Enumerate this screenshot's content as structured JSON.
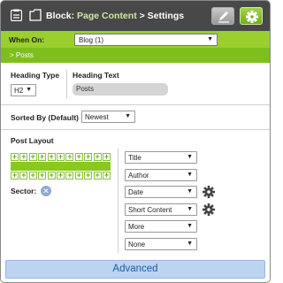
{
  "header": {
    "prefix": "Block:",
    "block_name": "Page Content",
    "suffix": "> Settings",
    "edit_icon": "pencil-icon",
    "settings_icon": "gear-icon"
  },
  "when_on": {
    "label": "When On:",
    "value": "Blog (1)"
  },
  "section": {
    "arrow": ">",
    "title": "Posts"
  },
  "heading": {
    "type_label": "Heading Type",
    "type_value": "H2",
    "text_label": "Heading Text",
    "text_value": "Posts"
  },
  "sorted_by": {
    "label": "Sorted By (Default)",
    "value": "Newest"
  },
  "post_layout": {
    "label": "Post Layout",
    "sector_label": "Sector:",
    "fields": [
      {
        "value": "Title",
        "gear": false
      },
      {
        "value": "Author",
        "gear": false
      },
      {
        "value": "Date",
        "gear": true
      },
      {
        "value": "Short Content",
        "gear": true
      },
      {
        "value": "More",
        "gear": false
      },
      {
        "value": "None",
        "gear": false
      }
    ]
  },
  "footer": {
    "advanced_label": "Advanced"
  },
  "colors": {
    "header_bg": "#484848",
    "accent_green": "#99d02d",
    "posts_bar": "#7fbf1c",
    "advanced_bg": "#bcd3f2"
  }
}
